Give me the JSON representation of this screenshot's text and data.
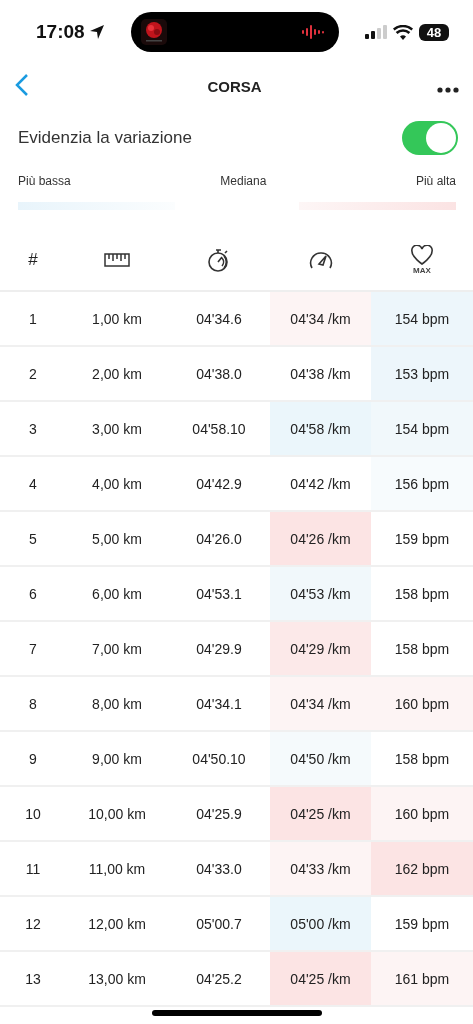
{
  "status_bar": {
    "time": "17:08",
    "battery": "48"
  },
  "nav": {
    "title": "CORSA"
  },
  "highlight": {
    "label": "Evidenzia la variazione",
    "on": true
  },
  "legend": {
    "low": "Più bassa",
    "mid": "Mediana",
    "high": "Più alta"
  },
  "table": {
    "columns": [
      {
        "kind": "text",
        "text": "#"
      },
      {
        "kind": "ruler"
      },
      {
        "kind": "stopwatch"
      },
      {
        "kind": "gauge"
      },
      {
        "kind": "heart",
        "text": "MAX"
      }
    ],
    "rows": [
      {
        "lap": "1",
        "distance": "1,00 km",
        "time": "04'34.6",
        "pace": {
          "text": "04'34 /km",
          "color": "#fdf4f4"
        },
        "hr": {
          "text": "154 bpm",
          "color": "#edf6fb"
        }
      },
      {
        "lap": "2",
        "distance": "2,00 km",
        "time": "04'38.0",
        "pace": {
          "text": "04'38 /km",
          "color": "#ffffff"
        },
        "hr": {
          "text": "153 bpm",
          "color": "#edf6fb"
        }
      },
      {
        "lap": "3",
        "distance": "3,00 km",
        "time": "04'58.10",
        "pace": {
          "text": "04'58 /km",
          "color": "#ebf6fb"
        },
        "hr": {
          "text": "154 bpm",
          "color": "#f1f8fb"
        }
      },
      {
        "lap": "4",
        "distance": "4,00 km",
        "time": "04'42.9",
        "pace": {
          "text": "04'42 /km",
          "color": "#ffffff"
        },
        "hr": {
          "text": "156 bpm",
          "color": "#f7fbfd"
        }
      },
      {
        "lap": "5",
        "distance": "5,00 km",
        "time": "04'26.0",
        "pace": {
          "text": "04'26 /km",
          "color": "#fce4e4"
        },
        "hr": {
          "text": "159 bpm",
          "color": "#ffffff"
        }
      },
      {
        "lap": "6",
        "distance": "6,00 km",
        "time": "04'53.1",
        "pace": {
          "text": "04'53 /km",
          "color": "#f1f8fb"
        },
        "hr": {
          "text": "158 bpm",
          "color": "#ffffff"
        }
      },
      {
        "lap": "7",
        "distance": "7,00 km",
        "time": "04'29.9",
        "pace": {
          "text": "04'29 /km",
          "color": "#fce9e9"
        },
        "hr": {
          "text": "158 bpm",
          "color": "#ffffff"
        }
      },
      {
        "lap": "8",
        "distance": "8,00 km",
        "time": "04'34.1",
        "pace": {
          "text": "04'34 /km",
          "color": "#fdf4f4"
        },
        "hr": {
          "text": "160 bpm",
          "color": "#fdf4f4"
        }
      },
      {
        "lap": "9",
        "distance": "9,00 km",
        "time": "04'50.10",
        "pace": {
          "text": "04'50 /km",
          "color": "#f5fafc"
        },
        "hr": {
          "text": "158 bpm",
          "color": "#ffffff"
        }
      },
      {
        "lap": "10",
        "distance": "10,00 km",
        "time": "04'25.9",
        "pace": {
          "text": "04'25 /km",
          "color": "#fce4e4"
        },
        "hr": {
          "text": "160 bpm",
          "color": "#fdf4f4"
        }
      },
      {
        "lap": "11",
        "distance": "11,00 km",
        "time": "04'33.0",
        "pace": {
          "text": "04'33 /km",
          "color": "#fdf4f4"
        },
        "hr": {
          "text": "162 bpm",
          "color": "#fce4e4"
        }
      },
      {
        "lap": "12",
        "distance": "12,00 km",
        "time": "05'00.7",
        "pace": {
          "text": "05'00 /km",
          "color": "#ebf6fb"
        },
        "hr": {
          "text": "159 bpm",
          "color": "#ffffff"
        }
      },
      {
        "lap": "13",
        "distance": "13,00 km",
        "time": "04'25.2",
        "pace": {
          "text": "04'25 /km",
          "color": "#fce4e4"
        },
        "hr": {
          "text": "161 bpm",
          "color": "#fdf4f4"
        }
      }
    ]
  }
}
